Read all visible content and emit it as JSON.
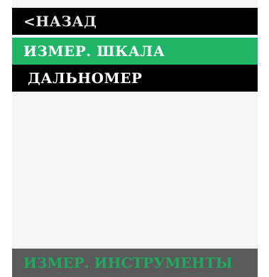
{
  "menu": {
    "back_label": "<НАЗАД",
    "items": [
      {
        "label": "ИЗМЕР. ШКАЛА",
        "selected": true
      },
      {
        "label": "ДАЛЬНОМЕР",
        "selected": false
      }
    ]
  },
  "footer": {
    "title": "ИЗМЕР. ИНСТРУМЕНТЫ"
  },
  "colors": {
    "accent": "#1fb566",
    "header_bg": "#000000",
    "footer_bg": "#5a5a5a",
    "footer_text": "#1fa860"
  }
}
